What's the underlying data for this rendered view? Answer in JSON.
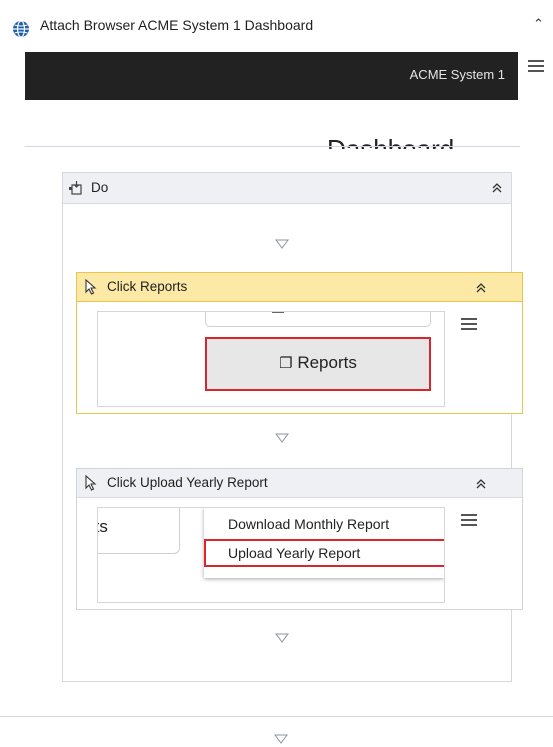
{
  "header": {
    "title": "Attach Browser ACME System 1 Dashboard",
    "collapse_icon": "double-chevron-up-icon",
    "menu_icon": "hamburger-icon"
  },
  "preview": {
    "app_name": "ACME System 1",
    "page_heading": "Dashboard"
  },
  "do_container": {
    "label": "Do",
    "icon": "sequence-icon",
    "collapse_icon": "double-chevron-up-icon"
  },
  "activities": [
    {
      "title": "Click Reports",
      "icon": "cursor-icon",
      "target_label": "Reports",
      "target_icon": "copy-icon",
      "selected": true
    },
    {
      "title": "Click Upload Yearly Report",
      "icon": "cursor-icon",
      "behind_button_text": "rts",
      "menu_items": [
        "Download Monthly Report",
        "Upload Yearly Report"
      ],
      "selected": false
    }
  ],
  "colors": {
    "highlight_red": "#d9262c",
    "selected_card_header": "#fde9a6",
    "selected_card_border": "#e8c54b",
    "card_header": "#eef0f3",
    "preview_bar": "#222222"
  }
}
